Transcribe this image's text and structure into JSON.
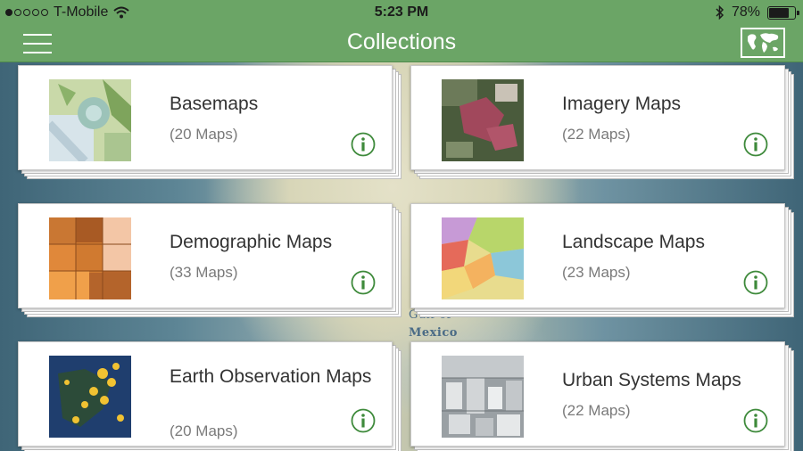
{
  "status_bar": {
    "carrier": "T-Mobile",
    "time": "5:23 PM",
    "battery": "78%",
    "battery_level": 0.78,
    "signal_bars_filled": 1,
    "signal_bars_total": 5,
    "icons": [
      "wifi-icon",
      "bluetooth-icon",
      "battery-icon"
    ]
  },
  "nav": {
    "title": "Collections",
    "left_icon": "hamburger-menu-icon",
    "right_icon": "world-map-icon"
  },
  "map": {
    "labels": [
      "Gulf of",
      "Mexico"
    ]
  },
  "collections": [
    {
      "title": "Basemaps",
      "count": "(20 Maps)",
      "thumb": "basemap-thumbnail"
    },
    {
      "title": "Imagery Maps",
      "count": "(22 Maps)",
      "thumb": "imagery-thumbnail"
    },
    {
      "title": "Demographic Maps",
      "count": "(33 Maps)",
      "thumb": "demographic-thumbnail"
    },
    {
      "title": "Landscape Maps",
      "count": "(23 Maps)",
      "thumb": "landscape-thumbnail"
    },
    {
      "title": "Earth Observation Maps",
      "count": "(20 Maps)",
      "thumb": "earth-observation-thumbnail"
    },
    {
      "title": "Urban Systems Maps",
      "count": "(22 Maps)",
      "thumb": "urban-systems-thumbnail"
    }
  ],
  "colors": {
    "header_green": "#6ba566",
    "info_green": "#3e8a3b",
    "card_background": "#ffffff"
  }
}
